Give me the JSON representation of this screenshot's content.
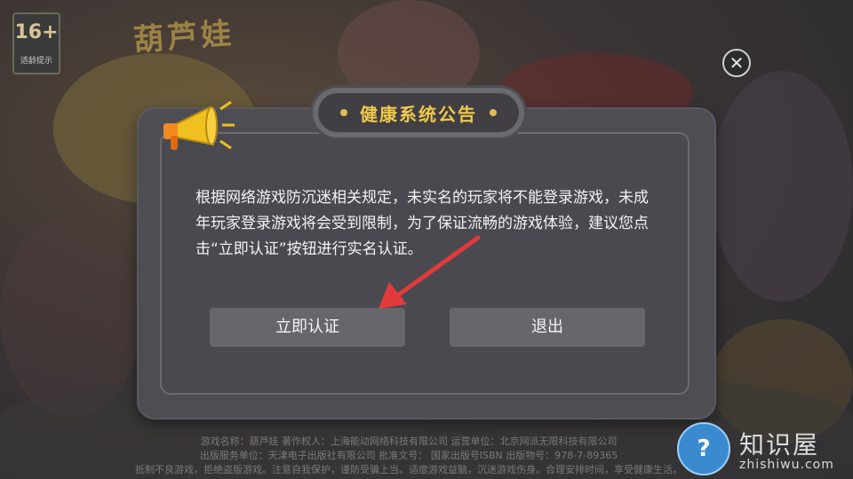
{
  "background": {
    "age_badge": {
      "rating": "16+",
      "tip": "适龄提示"
    },
    "game_title": "葫芦娃",
    "footer_lines": [
      "游戏名称：葫芦娃  著作权人：上海能动网络科技有限公司  运营单位：北京网派无限科技有限公司",
      "出版服务单位：天津电子出版社有限公司  批准文号：  国家出版号ISBN  出版物号：978-7-89365",
      "抵制不良游戏，拒绝盗版游戏。注意自我保护，谨防受骗上当。适度游戏益脑，沉迷游戏伤身。合理安排时间，享受健康生活。"
    ]
  },
  "close_button": {
    "icon": "close-icon",
    "symbol": "✕"
  },
  "dialog": {
    "title": "健康系统公告",
    "body": "根据网络游戏防沉迷相关规定，未实名的玩家将不能登录游戏，未成年玩家登录游戏将会受到限制，为了保证流畅的游戏体验，建议您点击“立即认证”按钮进行实名认证。",
    "buttons": {
      "verify": "立即认证",
      "exit": "退出"
    },
    "icon": "megaphone-icon",
    "accent_color": "#f0c84a"
  },
  "annotation": {
    "icon": "red-arrow-icon",
    "color": "#e23a3a"
  },
  "watermark": {
    "logo_symbol": "?",
    "title": "知识屋",
    "domain": "zhishiwu.com"
  }
}
